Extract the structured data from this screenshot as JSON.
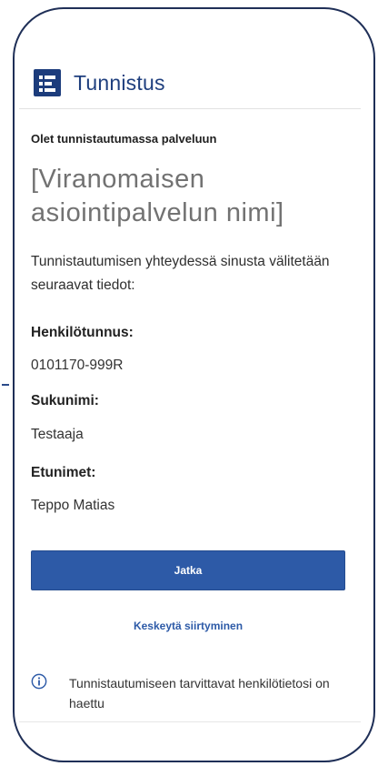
{
  "header": {
    "title": "Tunnistus"
  },
  "page": {
    "intro": "Olet tunnistautumassa palveluun",
    "service_name": "[Viranomaisen asiointipalvelun nimi]",
    "description": "Tunnistautumisen yhteydessä sinusta välitetään seuraavat tiedot:"
  },
  "fields": [
    {
      "label": "Henkilötunnus:",
      "value": "0101170-999R"
    },
    {
      "label": "Sukunimi:",
      "value": "Testaaja"
    },
    {
      "label": "Etunimet:",
      "value": "Teppo Matias"
    }
  ],
  "actions": {
    "continue_label": "Jatka",
    "cancel_label": "Keskeytä siirtyminen"
  },
  "notice": {
    "text": "Tunnistautumiseen tarvittavat henkilötietosi on haettu"
  },
  "colors": {
    "brand": "#1c3c7c",
    "button": "#2d5aa7",
    "link": "#2d5aa7",
    "frame": "#1f2f57"
  },
  "icons": {
    "logo": "list-logo-icon",
    "info": "info-circle-icon"
  }
}
